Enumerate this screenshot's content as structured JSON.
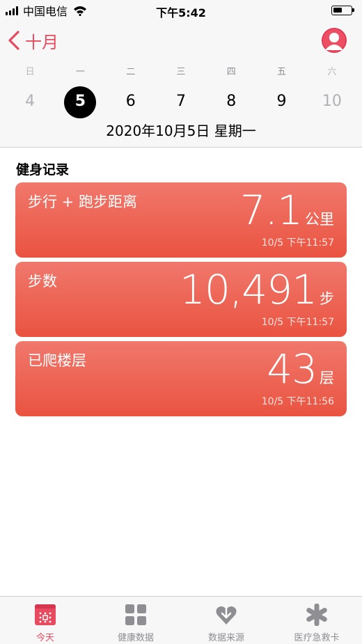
{
  "status_bar": {
    "carrier": "中国电信",
    "time": "下午5:42"
  },
  "header": {
    "back_label": "十月",
    "weekdays": [
      "日",
      "一",
      "二",
      "三",
      "四",
      "五",
      "六"
    ],
    "days": [
      "4",
      "5",
      "6",
      "7",
      "8",
      "9",
      "10"
    ],
    "selected_day": "5",
    "date_line": "2020年10月5日 星期一"
  },
  "section": {
    "title": "健身记录"
  },
  "cards": [
    {
      "title": "步行 + 跑步距离",
      "value": "7.1",
      "unit": "公里",
      "time": "10/5 下午11:57"
    },
    {
      "title": "步数",
      "value": "10,491",
      "unit": "步",
      "time": "10/5 下午11:57"
    },
    {
      "title": "已爬楼层",
      "value": "43",
      "unit": "层",
      "time": "10/5 下午11:56"
    }
  ],
  "tabbar": {
    "tabs": [
      {
        "label": "今天",
        "icon": "calendar-icon",
        "active": true
      },
      {
        "label": "健康数据",
        "icon": "grid-icon",
        "active": false
      },
      {
        "label": "数据来源",
        "icon": "heart-download-icon",
        "active": false
      },
      {
        "label": "医疗急救卡",
        "icon": "asterisk-icon",
        "active": false
      }
    ]
  },
  "colors": {
    "accent": "#e84a5f",
    "card_top": "#f0786c",
    "card_bottom": "#ea5340",
    "inactive": "#8e8e93"
  }
}
